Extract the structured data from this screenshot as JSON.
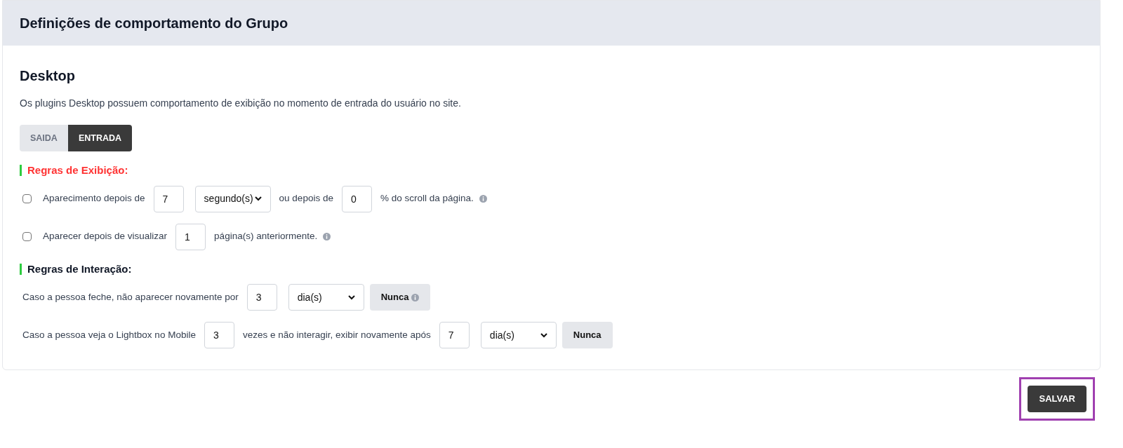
{
  "panel": {
    "title": "Definições de comportamento do Grupo"
  },
  "section": {
    "title": "Desktop",
    "description": "Os plugins Desktop possuem comportamento de exibição no momento de entrada do usuário no site."
  },
  "toggle": [
    {
      "label": "SAIDA",
      "selected": false
    },
    {
      "label": "ENTRADA",
      "selected": true
    }
  ],
  "groups": [
    {
      "title": "Regras de Exibição:",
      "color": "#ff3333",
      "rows": [
        {
          "items": [
            {
              "kind": "checkbox",
              "checked": false
            },
            {
              "kind": "text",
              "text": "Aparecimento depois de"
            },
            {
              "kind": "input",
              "value": "7"
            },
            {
              "kind": "select",
              "value": "segundo(s)"
            },
            {
              "kind": "text",
              "text": "ou depois de"
            },
            {
              "kind": "input",
              "value": "0"
            },
            {
              "kind": "text",
              "text": "% do scroll da página."
            },
            {
              "kind": "info"
            }
          ]
        },
        {
          "items": [
            {
              "kind": "checkbox",
              "checked": false
            },
            {
              "kind": "text",
              "text": "Aparecer depois de visualizar"
            },
            {
              "kind": "input",
              "value": "1"
            },
            {
              "kind": "text",
              "text": "página(s) anteriormente."
            },
            {
              "kind": "info"
            }
          ]
        }
      ]
    },
    {
      "title": "Regras de Interação:",
      "color": "#111827",
      "rows": [
        {
          "items": [
            {
              "kind": "text",
              "text": "Caso a pessoa feche, não aparecer novamente por"
            },
            {
              "kind": "input",
              "value": "3"
            },
            {
              "kind": "select",
              "value": "dia(s)"
            },
            {
              "kind": "button",
              "label": "Nunca",
              "info": true
            }
          ]
        },
        {
          "items": [
            {
              "kind": "text",
              "text": "Caso a pessoa veja o Lightbox no Mobile"
            },
            {
              "kind": "input",
              "value": "3"
            },
            {
              "kind": "text",
              "text": "vezes e não interagir, exibir novamente após"
            },
            {
              "kind": "input",
              "value": "7"
            },
            {
              "kind": "select",
              "value": "dia(s)"
            },
            {
              "kind": "button",
              "label": "Nunca",
              "info": false
            }
          ]
        }
      ]
    }
  ],
  "save": {
    "label": "SALVAR",
    "highlighted": true
  }
}
